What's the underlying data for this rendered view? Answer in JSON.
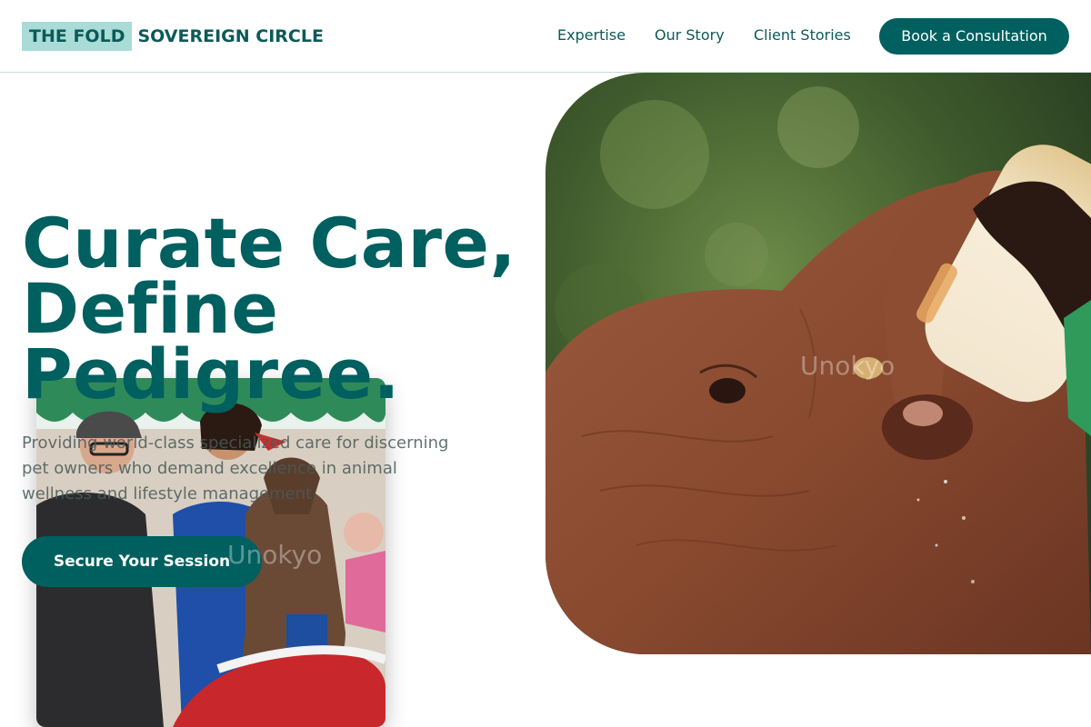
{
  "header": {
    "brand_badge": "THE FOLD",
    "brand_name": "SOVEREIGN CIRCLE",
    "nav": [
      {
        "label": "Expertise"
      },
      {
        "label": "Our Story"
      },
      {
        "label": "Client Stories"
      }
    ],
    "cta_label": "Book a Consultation"
  },
  "hero": {
    "headline_lines": [
      "Curate Care,",
      "Define",
      "Pedigree."
    ],
    "subcopy": "Providing world-class specialized care for discerning pet owners who demand excellence in animal wellness and lifestyle management.",
    "cta_label": "Secure Your Session"
  },
  "watermarks": {
    "main": "Unokyo",
    "inset": "Unokyo"
  },
  "colors": {
    "brand_teal": "#005f5f",
    "brand_badge_bg": "#a9dcd6",
    "body_text": "#4a5a5a"
  }
}
